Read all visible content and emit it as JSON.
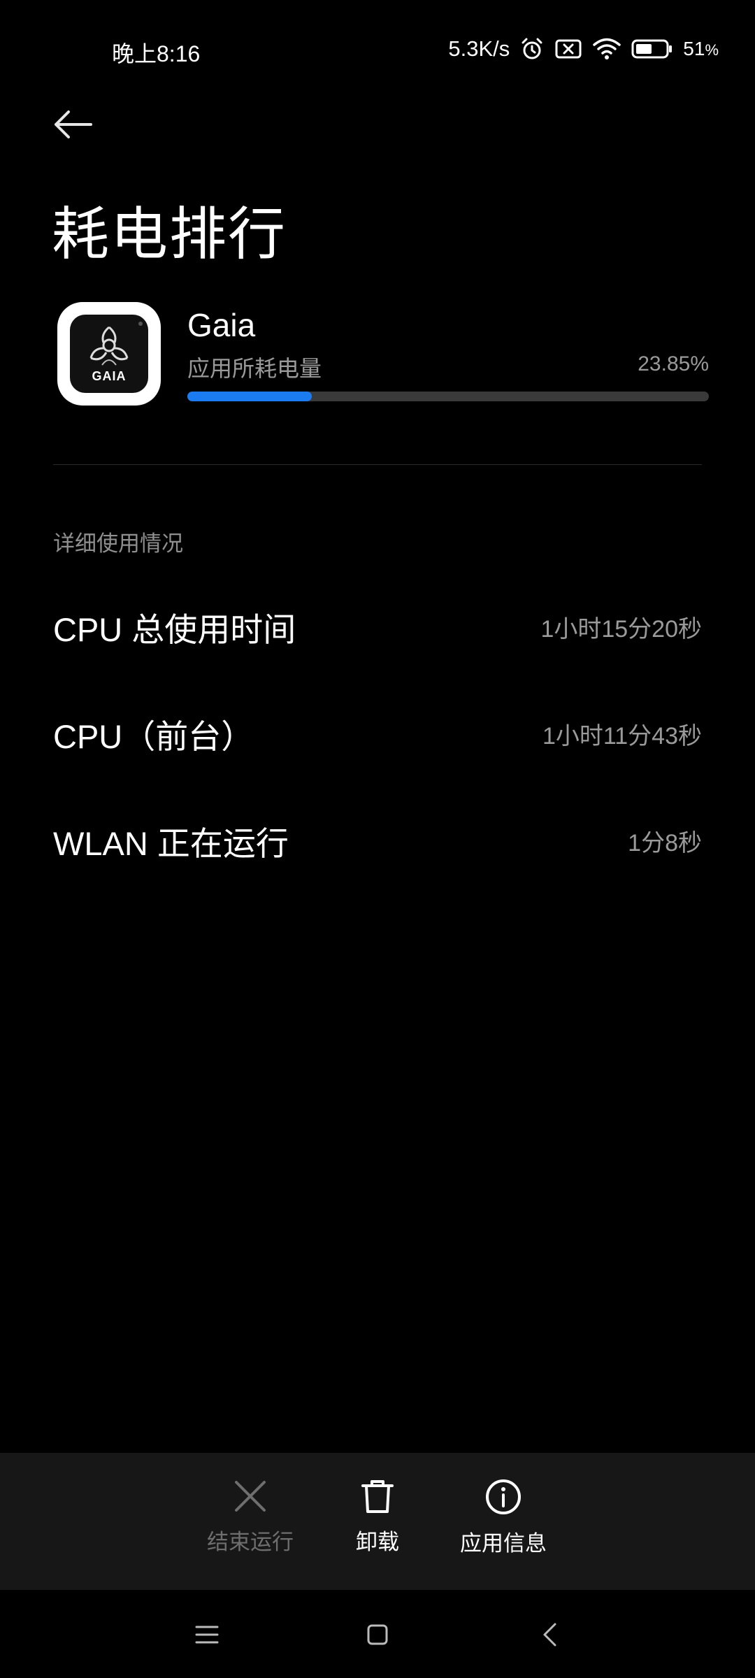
{
  "status_bar": {
    "time": "晚上8:16",
    "net_speed": "5.3K/s",
    "battery": "51",
    "battery_unit": "%",
    "icons": [
      "alarm-icon",
      "sim-off-icon",
      "wifi-icon",
      "battery-icon"
    ]
  },
  "page": {
    "title": "耗电排行"
  },
  "app": {
    "name": "Gaia",
    "icon_text": "GAIA",
    "subtitle": "应用所耗电量",
    "percent_text": "23.85%",
    "percent_value": 23.85,
    "accent_color": "#1b7cf2"
  },
  "details": {
    "section_title": "详细使用情况",
    "rows": [
      {
        "label": "CPU 总使用时间",
        "value": "1小时15分20秒"
      },
      {
        "label": "CPU（前台）",
        "value": "1小时11分43秒"
      },
      {
        "label": "WLAN 正在运行",
        "value": "1分8秒"
      }
    ]
  },
  "actions": [
    {
      "label": "结束运行",
      "icon": "close-icon",
      "enabled": false
    },
    {
      "label": "卸载",
      "icon": "trash-icon",
      "enabled": true
    },
    {
      "label": "应用信息",
      "icon": "info-icon",
      "enabled": true
    }
  ],
  "nav": [
    "menu-icon",
    "home-icon",
    "back-icon"
  ]
}
